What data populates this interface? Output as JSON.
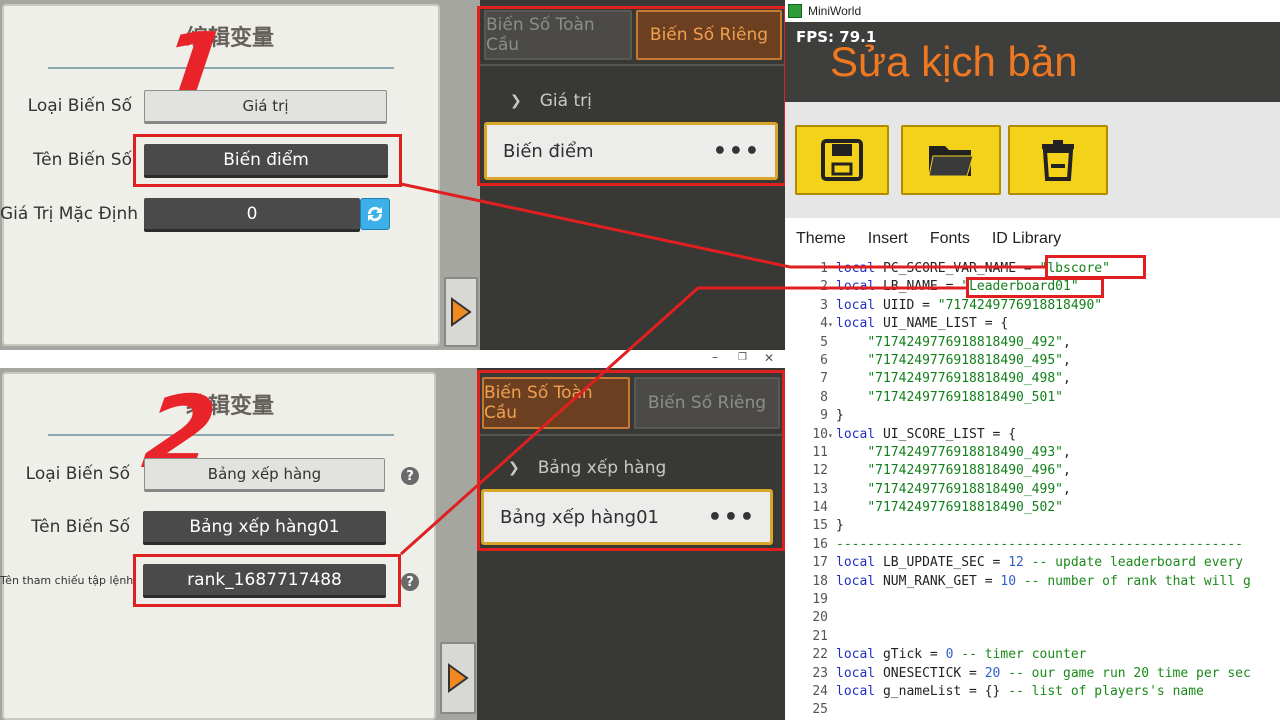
{
  "panel1": {
    "title": "编辑变量",
    "type_label": "Loại Biến Số",
    "type_value": "Giá trị",
    "name_label": "Tên Biến Số",
    "name_value": "Biến điểm",
    "default_label": "Giá Trị Mặc Định",
    "default_value": "0",
    "number_badge": "1"
  },
  "sidebar1": {
    "tab_global": "Biến Số Toàn Cầu",
    "tab_private": "Biến Số Riêng",
    "active_tab": "tab_private",
    "group": "Giá trị",
    "item": "Biến điểm",
    "more": "•••"
  },
  "panel2": {
    "title": "编辑变量",
    "type_label": "Loại Biến Số",
    "type_value": "Bảng xếp hàng",
    "name_label": "Tên Biến Số",
    "name_value": "Bảng xếp hàng01",
    "ref_label": "Tên tham chiếu tập lệnh",
    "ref_value": "rank_1687717488",
    "help": "?",
    "number_badge": "2"
  },
  "sidebar2": {
    "tab_global": "Biến Số Toàn Cầu",
    "tab_private": "Biến Số Riêng",
    "active_tab": "tab_global",
    "group": "Bảng xếp hàng",
    "item": "Bảng xếp hàng01",
    "more": "•••"
  },
  "editor": {
    "window_title": "MiniWorld",
    "fps": "FPS: 79.1",
    "title": "Sửa kịch bản",
    "menu": [
      "Theme",
      "Insert",
      "Fonts",
      "ID Library"
    ],
    "code": [
      {
        "n": "1",
        "parts": [
          [
            "kw",
            "local "
          ],
          [
            "txt",
            "PC_SCORE_VAR_NAME = "
          ],
          [
            "str",
            "\"lbscore\""
          ]
        ]
      },
      {
        "n": "2",
        "parts": [
          [
            "kw",
            "local "
          ],
          [
            "txt",
            "LB_NAME = "
          ],
          [
            "str",
            "\"Leaderboard01\""
          ]
        ]
      },
      {
        "n": "3",
        "parts": [
          [
            "kw",
            "local "
          ],
          [
            "txt",
            "UIID = "
          ],
          [
            "str",
            "\"7174249776918818490\""
          ]
        ]
      },
      {
        "n": "4",
        "fold": true,
        "parts": [
          [
            "kw",
            "local "
          ],
          [
            "txt",
            "UI_NAME_LIST = {"
          ]
        ]
      },
      {
        "n": "5",
        "parts": [
          [
            "txt",
            "    "
          ],
          [
            "str",
            "\"7174249776918818490_492\""
          ],
          [
            "txt",
            ","
          ]
        ]
      },
      {
        "n": "6",
        "parts": [
          [
            "txt",
            "    "
          ],
          [
            "str",
            "\"7174249776918818490_495\""
          ],
          [
            "txt",
            ","
          ]
        ]
      },
      {
        "n": "7",
        "parts": [
          [
            "txt",
            "    "
          ],
          [
            "str",
            "\"7174249776918818490_498\""
          ],
          [
            "txt",
            ","
          ]
        ]
      },
      {
        "n": "8",
        "parts": [
          [
            "txt",
            "    "
          ],
          [
            "str",
            "\"7174249776918818490_501\""
          ]
        ]
      },
      {
        "n": "9",
        "parts": [
          [
            "txt",
            "}"
          ]
        ]
      },
      {
        "n": "10",
        "fold": true,
        "parts": [
          [
            "kw",
            "local "
          ],
          [
            "txt",
            "UI_SCORE_LIST = {"
          ]
        ]
      },
      {
        "n": "11",
        "parts": [
          [
            "txt",
            "    "
          ],
          [
            "str",
            "\"7174249776918818490_493\""
          ],
          [
            "txt",
            ","
          ]
        ]
      },
      {
        "n": "12",
        "parts": [
          [
            "txt",
            "    "
          ],
          [
            "str",
            "\"7174249776918818490_496\""
          ],
          [
            "txt",
            ","
          ]
        ]
      },
      {
        "n": "13",
        "parts": [
          [
            "txt",
            "    "
          ],
          [
            "str",
            "\"7174249776918818490_499\""
          ],
          [
            "txt",
            ","
          ]
        ]
      },
      {
        "n": "14",
        "parts": [
          [
            "txt",
            "    "
          ],
          [
            "str",
            "\"7174249776918818490_502\""
          ]
        ]
      },
      {
        "n": "15",
        "parts": [
          [
            "txt",
            "}"
          ]
        ]
      },
      {
        "n": "16",
        "parts": [
          [
            "cmt",
            "----------------------------------------------------"
          ]
        ]
      },
      {
        "n": "17",
        "parts": [
          [
            "kw",
            "local "
          ],
          [
            "txt",
            "LB_UPDATE_SEC = "
          ],
          [
            "num",
            "12"
          ],
          [
            "cmt",
            " -- update leaderboard every"
          ]
        ]
      },
      {
        "n": "18",
        "parts": [
          [
            "kw",
            "local "
          ],
          [
            "txt",
            "NUM_RANK_GET = "
          ],
          [
            "num",
            "10"
          ],
          [
            "cmt",
            " -- number of rank that will g"
          ]
        ]
      },
      {
        "n": "19",
        "parts": []
      },
      {
        "n": "20",
        "parts": []
      },
      {
        "n": "21",
        "parts": []
      },
      {
        "n": "22",
        "parts": [
          [
            "kw",
            "local "
          ],
          [
            "txt",
            "gTick = "
          ],
          [
            "num",
            "0"
          ],
          [
            "cmt",
            " -- timer counter"
          ]
        ]
      },
      {
        "n": "23",
        "parts": [
          [
            "kw",
            "local "
          ],
          [
            "txt",
            "ONESECTICK = "
          ],
          [
            "num",
            "20"
          ],
          [
            "cmt",
            " -- our game run 20 time per sec"
          ]
        ]
      },
      {
        "n": "24",
        "parts": [
          [
            "kw",
            "local "
          ],
          [
            "txt",
            "g_nameList = {} "
          ],
          [
            "cmt",
            "-- list of players's name"
          ]
        ]
      },
      {
        "n": "25",
        "parts": []
      }
    ]
  },
  "colors": {
    "accent_orange": "#f07820",
    "highlight_red": "#e02020",
    "toolbar_yellow": "#f5d21a",
    "item_border": "#d9a629"
  }
}
